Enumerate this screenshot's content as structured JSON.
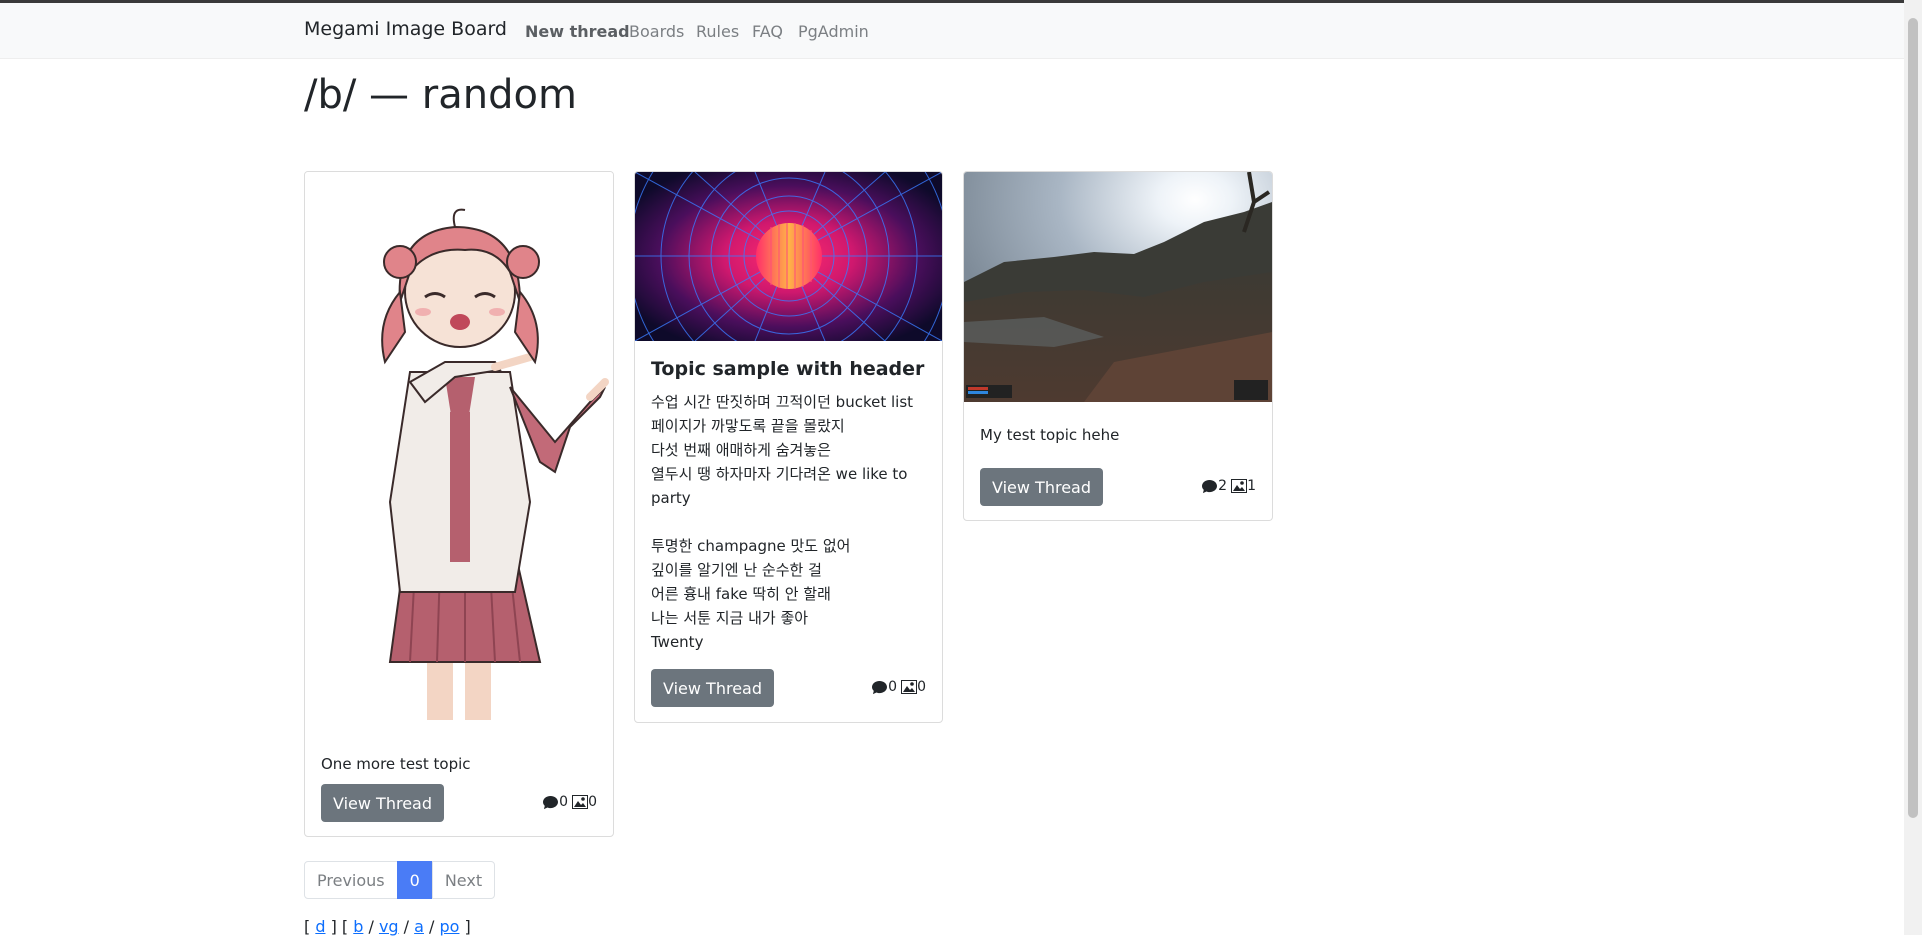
{
  "navbar": {
    "brand": "Megami Image Board",
    "links": [
      "New thread",
      "Boards",
      "Rules",
      "FAQ",
      "PgAdmin"
    ]
  },
  "page": {
    "title": "/b/ — random"
  },
  "cards": [
    {
      "image": "anime-girl-pointing",
      "title": "",
      "text": "One more test topic",
      "button": "View Thread",
      "replies": "0",
      "images": "0"
    },
    {
      "image": "synthwave-sun-grid",
      "title": "Topic sample with header",
      "text": "수업 시간 딴짓하며 끄적이던 bucket list\n페이지가 까맣도록 끝을 몰랐지\n다섯 번째 애매하게 숨겨놓은\n열두시 땡 하자마자 기다려온 we like to\nparty\n\n투명한 champagne 맛도 없어\n깊이를 알기엔 난 순수한 걸\n어른 흉내 fake 딱히 안 할래\n나는 서툰 지금 내가 좋아\nTwenty",
      "button": "View Thread",
      "replies": "0",
      "images": "0"
    },
    {
      "image": "game-landscape-screenshot",
      "title": "",
      "text": "My test topic hehe",
      "button": "View Thread",
      "replies": "2",
      "images": "1"
    }
  ],
  "pagination": {
    "previous": "Previous",
    "current": "0",
    "next": "Next"
  },
  "boards": {
    "group1": [
      "d"
    ],
    "group2": [
      "b",
      "vg",
      "a",
      "po"
    ]
  },
  "icons": {
    "replies": "comment-icon",
    "images": "image-icon"
  },
  "colors": {
    "button": "#6c757d",
    "pagination_active": "#4a7cf6",
    "link": "#0d6efd"
  }
}
